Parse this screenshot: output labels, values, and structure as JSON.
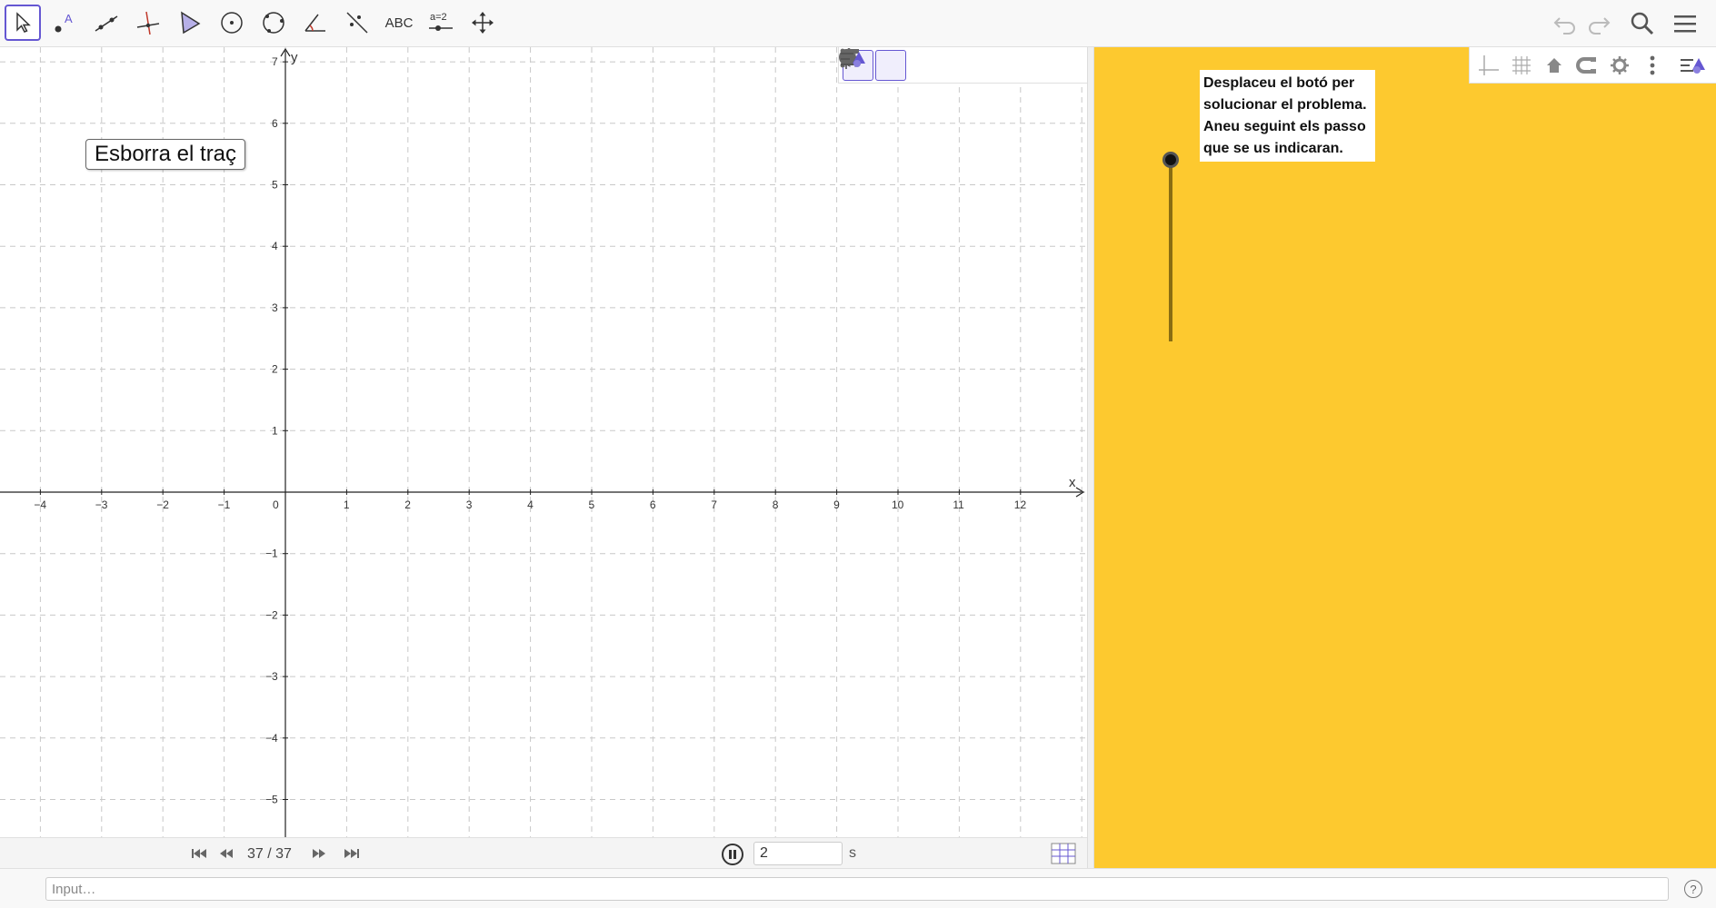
{
  "toolbar": {
    "text_tool_label": "ABC",
    "slider_tool_label": "a=2",
    "point_tool_letter": "A",
    "tools": [
      "move-tool",
      "point-tool",
      "line-tool",
      "perpendicular-line-tool",
      "polygon-tool",
      "circle-center-tool",
      "circle-three-points-tool",
      "angle-tool",
      "reflect-tool",
      "text-tool",
      "slider-tool",
      "move-graphics-tool"
    ],
    "selected_tool": "move-tool",
    "accent_color": "#6557d2"
  },
  "graphics1": {
    "x_axis_name": "x",
    "y_axis_name": "y",
    "x_ticks": [
      "−4",
      "−3",
      "−2",
      "−1",
      "0",
      "1",
      "2",
      "3",
      "4",
      "5",
      "6",
      "7",
      "8",
      "9",
      "10",
      "11",
      "12"
    ],
    "y_ticks": [
      "7",
      "6",
      "5",
      "4",
      "3",
      "2",
      "1",
      "−1",
      "−2",
      "−3",
      "−4",
      "−5"
    ],
    "erase_button_label": "Esborra el traç"
  },
  "animation": {
    "step_label": "37 / 37",
    "speed_value": "2",
    "speed_unit": "s"
  },
  "graphics2": {
    "background_color": "#fdc92f",
    "info_lines": [
      "Desplaceu el botó per",
      "solucionar el problema.",
      "Aneu seguint els passo",
      "que se us indicaran."
    ]
  },
  "input_bar": {
    "placeholder": "Input…",
    "help_label": "?"
  }
}
